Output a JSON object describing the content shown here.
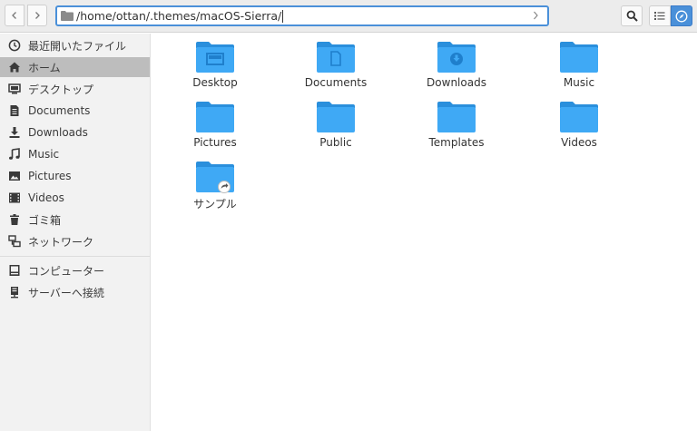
{
  "header": {
    "path": "/home/ottan/.themes/macOS-Sierra/",
    "back_icon": "chevron-left-icon",
    "forward_icon": "chevron-right-icon",
    "search_icon": "search-icon",
    "list_icon": "list-view-icon",
    "compass_icon": "compass-icon"
  },
  "sidebar": {
    "items": [
      {
        "label": "最近開いたファイル",
        "icon": "clock-icon"
      },
      {
        "label": "ホーム",
        "icon": "home-icon",
        "active": true
      },
      {
        "label": "デスクトップ",
        "icon": "desktop-icon"
      },
      {
        "label": "Documents",
        "icon": "document-icon"
      },
      {
        "label": "Downloads",
        "icon": "download-icon"
      },
      {
        "label": "Music",
        "icon": "music-icon"
      },
      {
        "label": "Pictures",
        "icon": "picture-icon"
      },
      {
        "label": "Videos",
        "icon": "video-icon"
      },
      {
        "label": "ゴミ箱",
        "icon": "trash-icon"
      },
      {
        "label": "ネットワーク",
        "icon": "network-icon"
      },
      {
        "label": "コンピューター",
        "icon": "computer-icon"
      },
      {
        "label": "サーバーへ接続",
        "icon": "server-icon"
      }
    ]
  },
  "files": [
    {
      "label": "Desktop",
      "icon": "folder-desktop-icon"
    },
    {
      "label": "Documents",
      "icon": "folder-documents-icon"
    },
    {
      "label": "Downloads",
      "icon": "folder-downloads-icon"
    },
    {
      "label": "Music",
      "icon": "folder-icon"
    },
    {
      "label": "Pictures",
      "icon": "folder-icon"
    },
    {
      "label": "Public",
      "icon": "folder-icon"
    },
    {
      "label": "Templates",
      "icon": "folder-icon"
    },
    {
      "label": "Videos",
      "icon": "folder-icon"
    },
    {
      "label": "サンプル",
      "icon": "folder-link-icon"
    }
  ],
  "colors": {
    "accent": "#4a90d9",
    "folder": "#3fa9f5",
    "folder_dark": "#2a8fdc",
    "sidebar_active": "#bdbdbd"
  }
}
